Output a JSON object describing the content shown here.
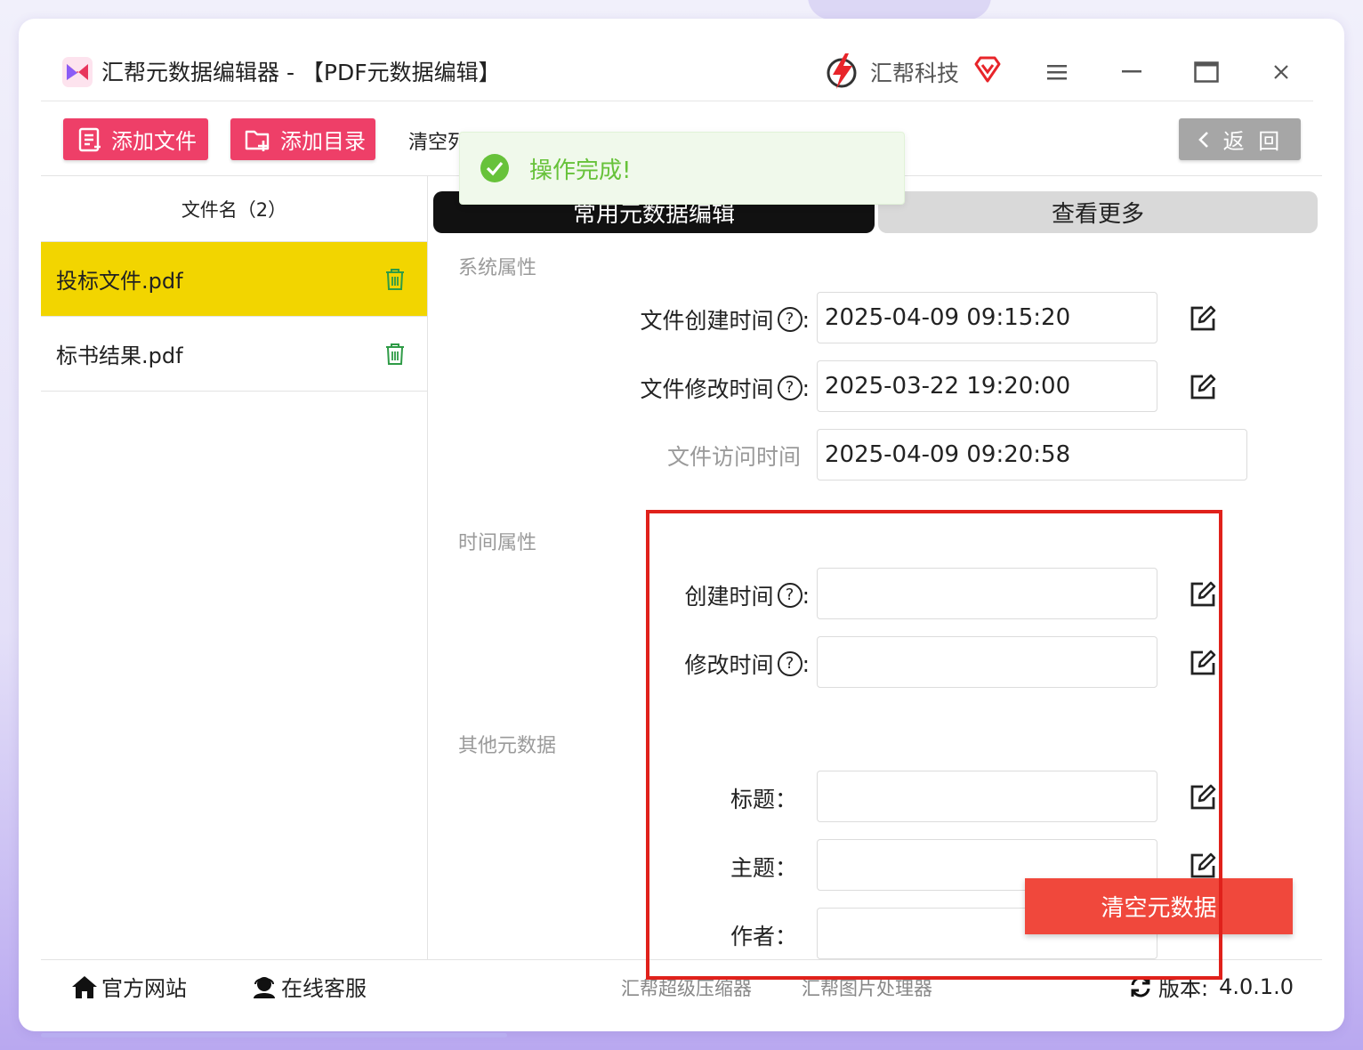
{
  "app": {
    "title": "汇帮元数据编辑器 - 【PDF元数据编辑】",
    "brand_name": "汇帮科技",
    "accent": "#ee3f68"
  },
  "toolbar": {
    "add_file_label": "添加文件",
    "add_dir_label": "添加目录",
    "clear_list_label": "清空列表",
    "back_label": "返 回"
  },
  "file_list": {
    "header": "文件名（2）",
    "items": [
      {
        "name": "投标文件.pdf",
        "selected": true
      },
      {
        "name": "标书结果.pdf",
        "selected": false
      }
    ],
    "selected_color": "#f2d500"
  },
  "tabs": {
    "active": "常用元数据编辑",
    "more": "查看更多"
  },
  "toast": {
    "message": "操作完成!",
    "color": "#67c23a"
  },
  "system_props": {
    "section": "系统属性",
    "created_label": "文件创建时间",
    "created_value": "2025-04-09 09:15:20",
    "modified_label": "文件修改时间",
    "modified_value": "2025-03-22 19:20:00",
    "accessed_label": "文件访问时间",
    "accessed_value": "2025-04-09 09:20:58"
  },
  "time_props": {
    "section": "时间属性",
    "created_label": "创建时间",
    "created_value": "",
    "modified_label": "修改时间",
    "modified_value": ""
  },
  "other_meta": {
    "section": "其他元数据",
    "title_label": "标题：",
    "title_value": "",
    "subject_label": "主题：",
    "subject_value": "",
    "author_label": "作者：",
    "author_value": ""
  },
  "clear_meta_label": "清空元数据",
  "colon": ":",
  "help_glyph": "?",
  "footer": {
    "website": "官方网站",
    "support": "在线客服",
    "app1": "汇帮超级压缩器",
    "app2": "汇帮图片处理器",
    "version_label": "版本:",
    "version_value": "4.0.1.0"
  }
}
